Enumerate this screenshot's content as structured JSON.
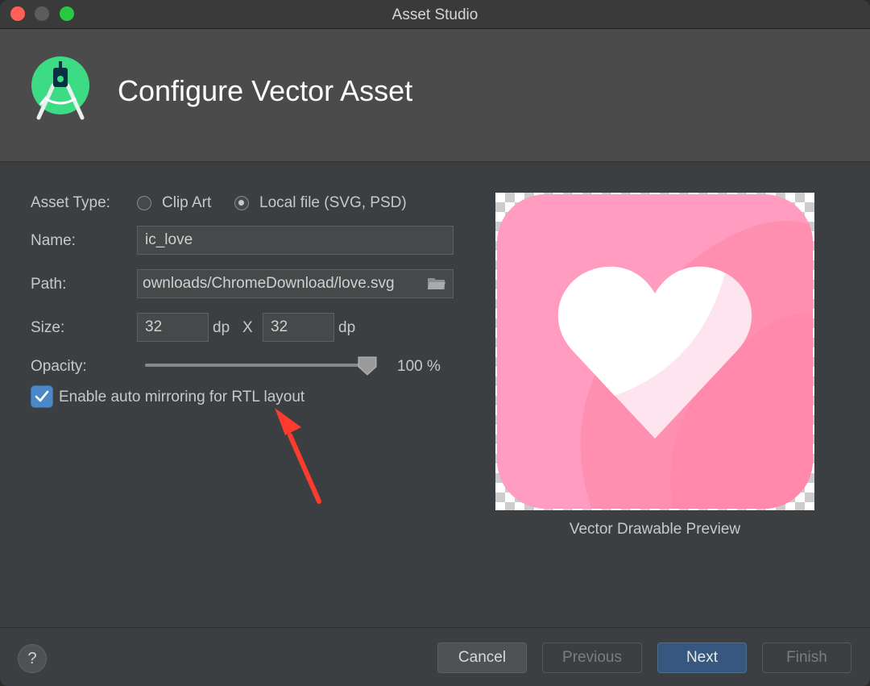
{
  "window": {
    "title": "Asset Studio"
  },
  "header": {
    "title": "Configure Vector Asset",
    "logo_icon": "android-studio-logo-icon"
  },
  "form": {
    "asset_type": {
      "label": "Asset Type:",
      "options": [
        {
          "label": "Clip Art",
          "selected": false
        },
        {
          "label": "Local file (SVG, PSD)",
          "selected": true
        }
      ]
    },
    "name": {
      "label": "Name:",
      "value": "ic_love"
    },
    "path": {
      "label": "Path:",
      "value": "ownloads/ChromeDownload/love.svg",
      "browse_icon": "folder-icon"
    },
    "size": {
      "label": "Size:",
      "width": "32",
      "height": "32",
      "unit": "dp",
      "separator": "X"
    },
    "opacity": {
      "label": "Opacity:",
      "value": 100,
      "display": "100 %"
    },
    "auto_mirror": {
      "label": "Enable auto mirroring for RTL layout",
      "checked": true
    }
  },
  "preview": {
    "caption": "Vector Drawable Preview"
  },
  "footer": {
    "help_label": "?",
    "cancel_label": "Cancel",
    "previous_label": "Previous",
    "next_label": "Next",
    "finish_label": "Finish"
  },
  "colors": {
    "accent": "#4a88c7",
    "primary_button": "#365880",
    "annotation_arrow": "#ff3b2f",
    "preview_pink": "#ff8fb1"
  }
}
